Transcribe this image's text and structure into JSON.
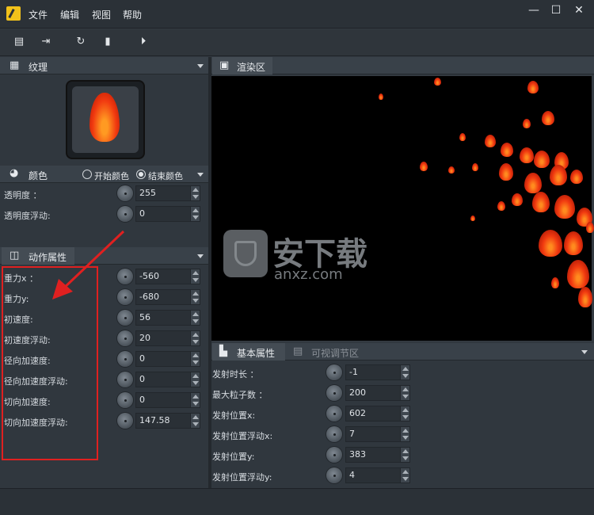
{
  "menu": {
    "file": "文件",
    "edit": "编辑",
    "view": "视图",
    "help": "帮助"
  },
  "window": {
    "minimize": "—",
    "maximize": "☐",
    "close": "✕"
  },
  "texture_panel": {
    "title": "纹理"
  },
  "color_panel": {
    "title": "颜色",
    "start_color": "开始颜色",
    "end_color": "结束颜色",
    "end_selected": true,
    "rows": [
      {
        "label": "透明度 ：",
        "value": "255"
      },
      {
        "label": "透明度浮动:",
        "value": "0"
      }
    ]
  },
  "motion_panel": {
    "title": "动作属性",
    "rows": [
      {
        "label": "重力x ：",
        "value": "-560"
      },
      {
        "label": "重力y:",
        "value": "-680"
      },
      {
        "label": "初速度:",
        "value": "56"
      },
      {
        "label": "初速度浮动:",
        "value": "20"
      },
      {
        "label": "径向加速度:",
        "value": "0"
      },
      {
        "label": "径向加速度浮动:",
        "value": "0"
      },
      {
        "label": "切向加速度:",
        "value": "0"
      },
      {
        "label": "切向加速度浮动:",
        "value": "147.58"
      }
    ]
  },
  "render_panel": {
    "title": "渲染区"
  },
  "basic_panel": {
    "tab_basic": "基本属性",
    "tab_visual": "可视调节区",
    "rows": [
      {
        "label": "发射时长 ：",
        "value": "-1"
      },
      {
        "label": "最大粒子数 ：",
        "value": "200"
      },
      {
        "label": "发射位置x:",
        "value": "602"
      },
      {
        "label": "发射位置浮动x:",
        "value": "7"
      },
      {
        "label": "发射位置y:",
        "value": "383"
      },
      {
        "label": "发射位置浮动y:",
        "value": "4"
      }
    ]
  },
  "watermark": {
    "brand": "安下载",
    "domain": "anxz.com"
  },
  "colors": {
    "highlight_box": "#e02020",
    "arrow": "#e02020",
    "flame": "#f13a10",
    "accent": "#f2c21a"
  },
  "icons": [
    "app-logo-icon",
    "new-file-icon",
    "export-icon",
    "refresh-icon",
    "fit-icon",
    "play-icon",
    "grid-icon",
    "palette-icon",
    "monitor-icon",
    "properties-icon",
    "visual-adjust-icon"
  ]
}
